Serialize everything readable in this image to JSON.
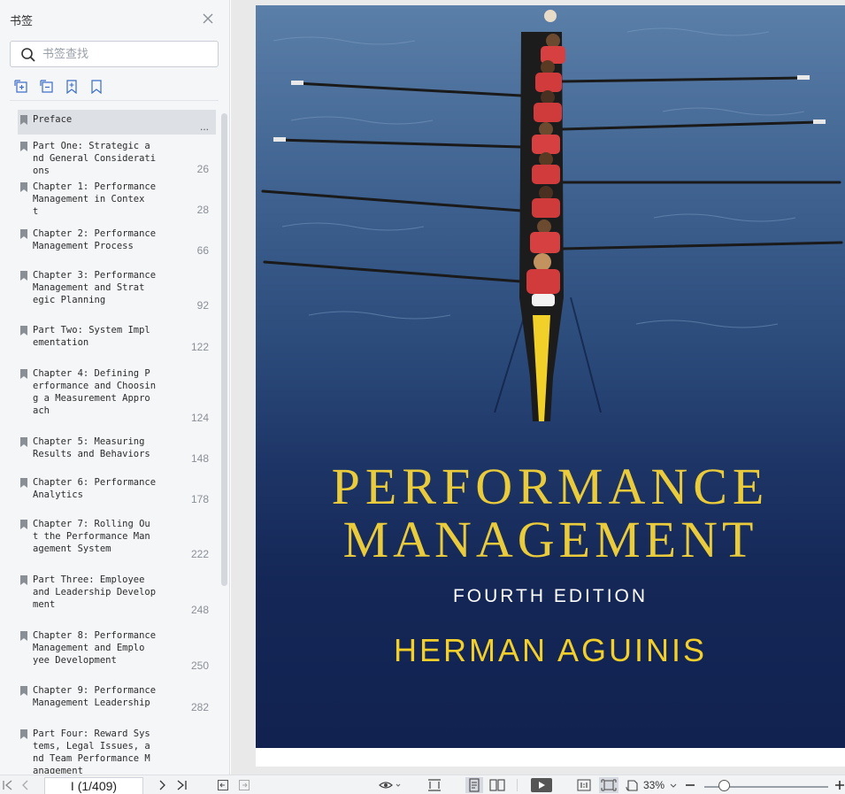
{
  "sidebar": {
    "title": "书签",
    "search_placeholder": "书签查找",
    "icons": [
      "expand-all-icon",
      "collapse-all-icon",
      "add-bookmark-icon",
      "bookmark-outline-icon"
    ],
    "items": [
      {
        "label": "Preface",
        "page": "...",
        "active": true
      },
      {
        "label": "Part  One:  Strategic  a\nnd  General  Considerati\nons",
        "page": "26"
      },
      {
        "label": "Chapter  1:  Performance\n  Management  in  Contex\nt",
        "page": "28"
      },
      {
        "label": "Chapter  2:  Performance\n  Management  Process",
        "page": "66"
      },
      {
        "label": "Chapter  3:  Performance\n  Management  and  Strat\negic  Planning",
        "page": "92"
      },
      {
        "label": "Part  Two:  System  Impl\nementation",
        "page": "122"
      },
      {
        "label": "Chapter  4:  Defining  P\nerformance  and  Choosin\ng  a  Measurement  Appro\nach",
        "page": "124"
      },
      {
        "label": "Chapter  5:  Measuring\nResults  and  Behaviors",
        "page": "148"
      },
      {
        "label": "Chapter  6:  Performance\n  Analytics",
        "page": "178"
      },
      {
        "label": "Chapter  7:  Rolling  Ou\nt  the  Performance  Man\nagement  System",
        "page": "222"
      },
      {
        "label": "Part  Three:  Employee\nand  Leadership  Develop\nment",
        "page": "248"
      },
      {
        "label": "Chapter  8:  Performance\n  Management  and  Emplo\nyee  Development",
        "page": "250"
      },
      {
        "label": "Chapter  9:  Performance\n  Management  Leadership",
        "page": "282"
      },
      {
        "label": "Part  Four:  Reward  Sys\ntems,  Legal  Issues,  a\nnd  Team  Performance  M\nanagement",
        "page": ""
      }
    ]
  },
  "cover": {
    "title_line1": "PERFORMANCE",
    "title_line2": "MANAGEMENT",
    "edition": "FOURTH EDITION",
    "author": "HERMAN AGUINIS"
  },
  "statusbar": {
    "page_indicator": "I (1/409)",
    "zoom": "33%",
    "zoom_level": 0.33
  },
  "colors": {
    "title_gold": "#e9cb3c",
    "author_gold": "#f2cf2a",
    "cover_navy": "#142756",
    "sidebar_bg": "#f5f6f8",
    "active_row": "#dde0e5"
  }
}
